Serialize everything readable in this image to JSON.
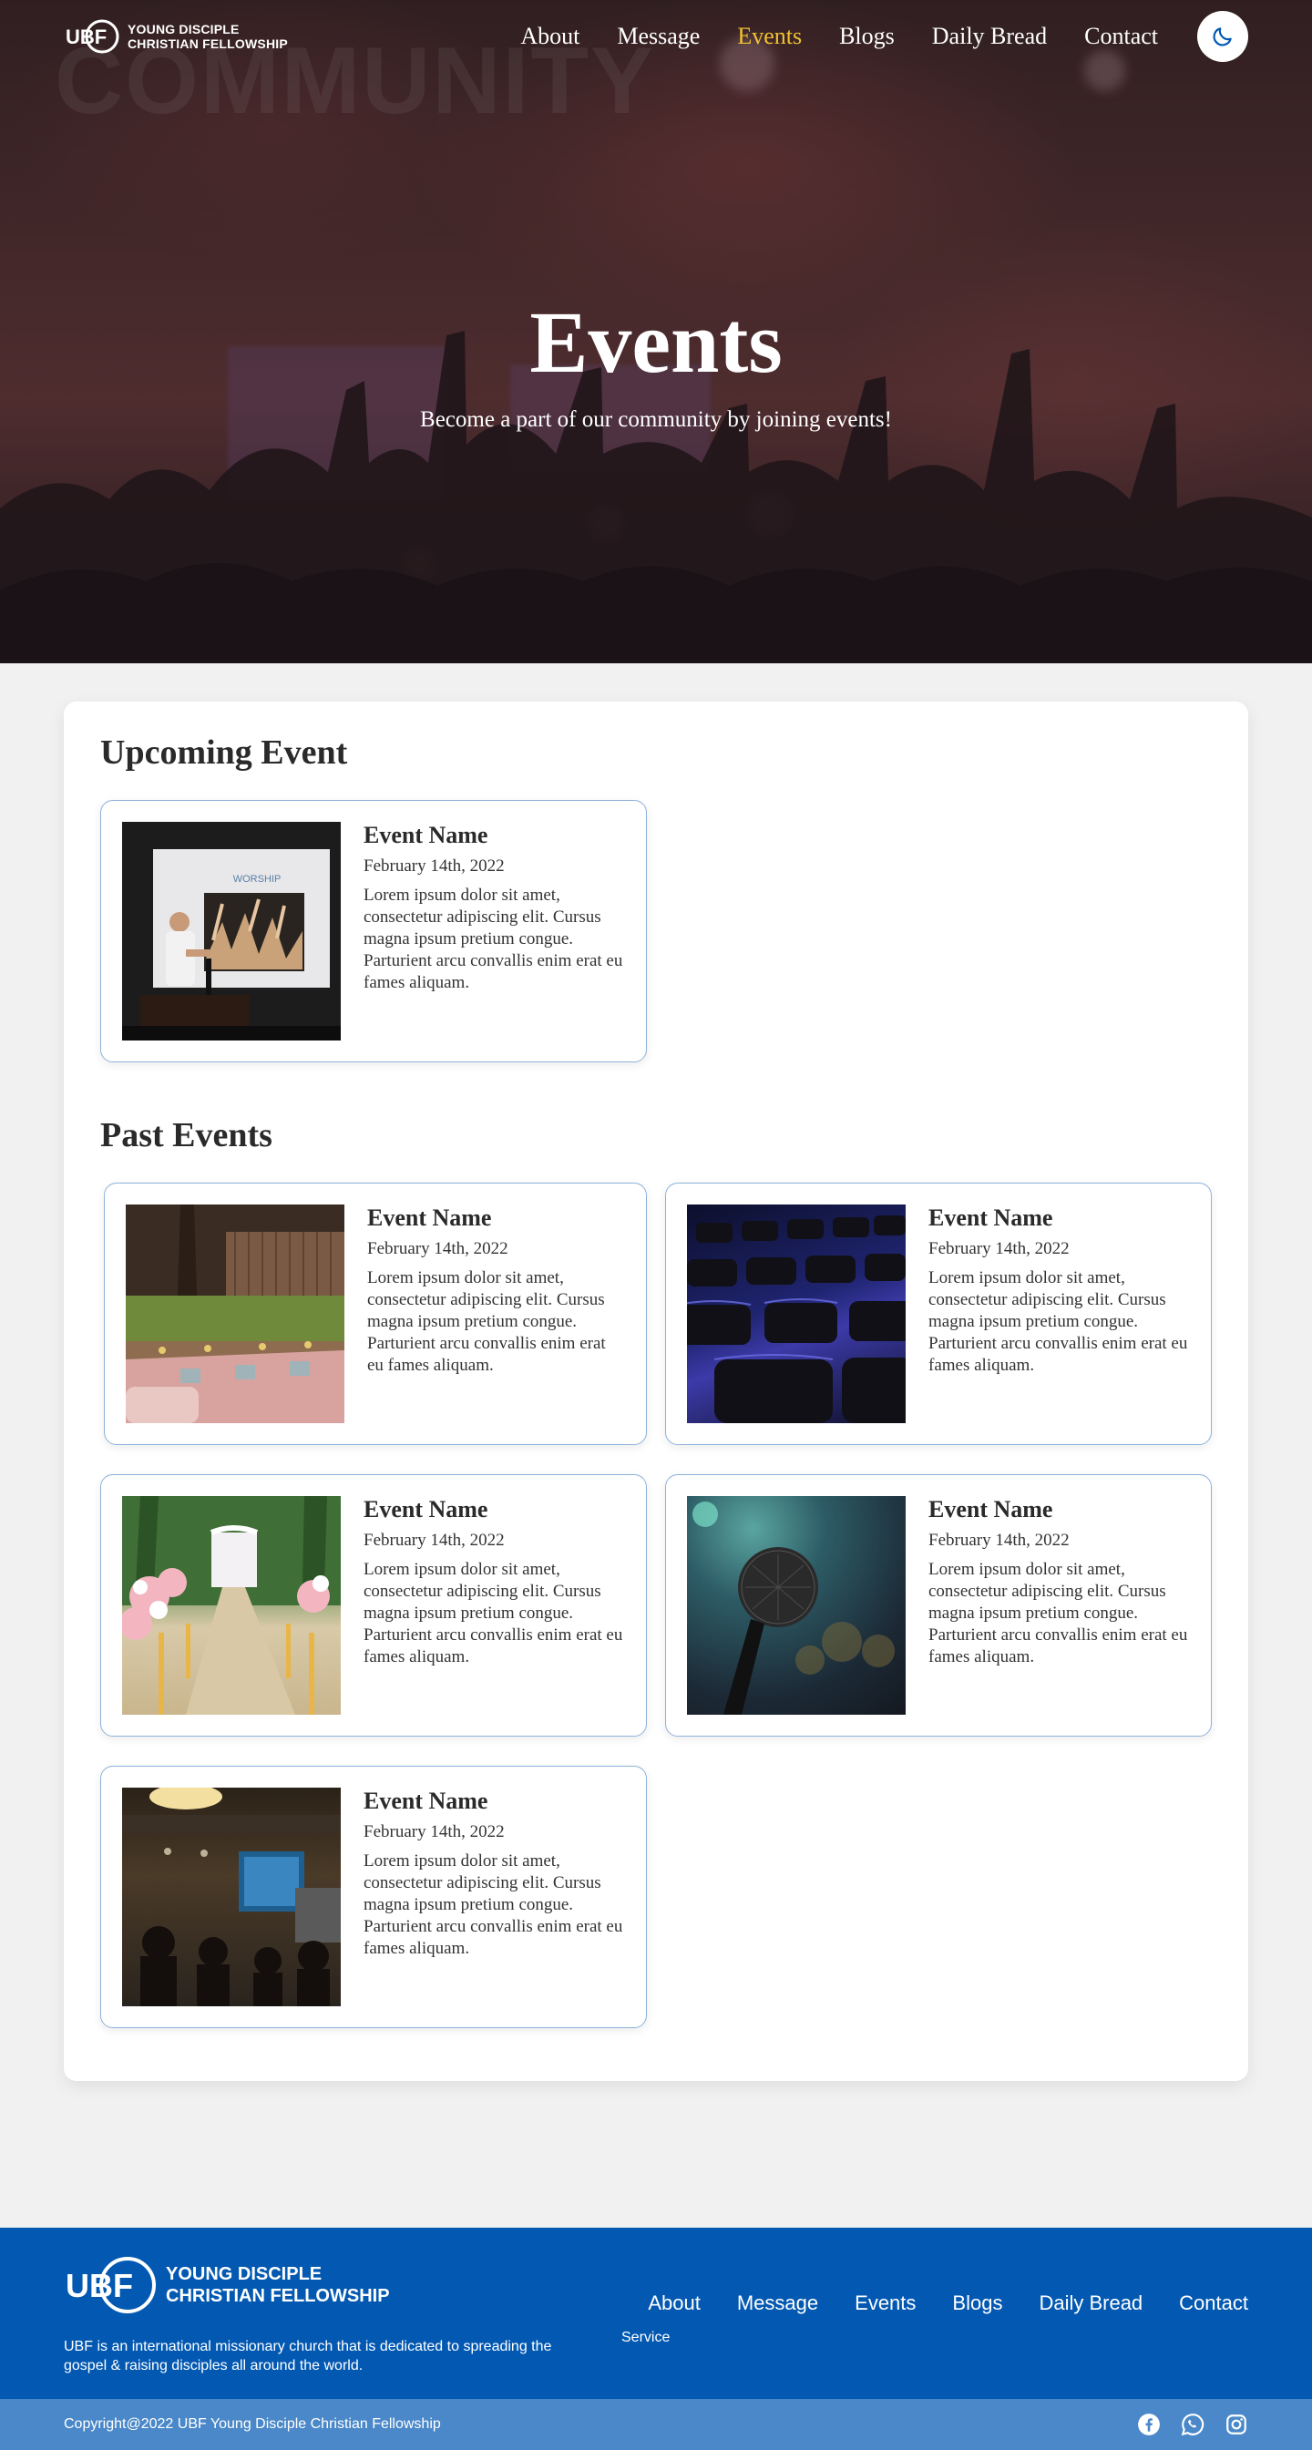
{
  "brand": {
    "line1": "YOUNG DISCIPLE",
    "line2": "CHRISTIAN FELLOWSHIP",
    "logo_letters": "UBF",
    "accent_color": "#f1c232",
    "primary_color": "#0359b2"
  },
  "nav": {
    "items": [
      {
        "label": "About"
      },
      {
        "label": "Message"
      },
      {
        "label": "Events",
        "active": true
      },
      {
        "label": "Blogs"
      },
      {
        "label": "Daily Bread"
      },
      {
        "label": "Contact"
      }
    ],
    "theme_toggle_icon": "moon-icon"
  },
  "hero": {
    "background_word": "COMMUNITY",
    "title": "Events",
    "subtitle": "Become a part of our community by joining events!"
  },
  "upcoming": {
    "heading": "Upcoming Event",
    "events": [
      {
        "image": "worship-presentation",
        "screen_text": "WORSHIP",
        "name": "Event Name",
        "date": "February 14th, 2022",
        "description": "Lorem ipsum dolor sit amet, consectetur adipiscing elit. Cursus magna ipsum pretium congue. Parturient arcu convallis enim erat eu fames aliquam."
      }
    ]
  },
  "past": {
    "heading": "Past Events",
    "events": [
      {
        "image": "garden-picnic",
        "name": "Event Name",
        "date": "February 14th, 2022",
        "description": "Lorem ipsum dolor sit amet, consectetur adipiscing elit. Cursus magna ipsum pretium congue. Parturient arcu convallis enim erat eu fames aliquam."
      },
      {
        "image": "empty-chairs",
        "name": "Event Name",
        "date": "February 14th, 2022",
        "description": "Lorem ipsum dolor sit amet, consectetur adipiscing elit. Cursus magna ipsum pretium congue. Parturient arcu convallis enim erat eu fames aliquam."
      },
      {
        "image": "flower-aisle",
        "name": "Event Name",
        "date": "February 14th, 2022",
        "description": "Lorem ipsum dolor sit amet, consectetur adipiscing elit. Cursus magna ipsum pretium congue. Parturient arcu convallis enim erat eu fames aliquam."
      },
      {
        "image": "microphone",
        "name": "Event Name",
        "date": "February 14th, 2022",
        "description": "Lorem ipsum dolor sit amet, consectetur adipiscing elit. Cursus magna ipsum pretium congue. Parturient arcu convallis enim erat eu fames aliquam."
      },
      {
        "image": "cafe-gathering",
        "name": "Event Name",
        "date": "February 14th, 2022",
        "description": "Lorem ipsum dolor sit amet, consectetur adipiscing elit. Cursus magna ipsum pretium congue. Parturient arcu convallis enim erat eu fames aliquam."
      }
    ]
  },
  "footer": {
    "brand_line1": "YOUNG DISCIPLE",
    "brand_line2": "CHRISTIAN FELLOWSHIP",
    "about": "UBF is an international missionary church that is dedicated to spreading the gospel & raising disciples all around the world.",
    "links": [
      {
        "label": "About"
      },
      {
        "label": "Message"
      },
      {
        "label": "Events"
      },
      {
        "label": "Blogs"
      },
      {
        "label": "Daily Bread"
      },
      {
        "label": "Contact"
      }
    ],
    "sub_link": "Service",
    "copyright": "Copyright@2022 UBF Young Disciple Christian Fellowship",
    "socials": [
      "facebook-icon",
      "whatsapp-icon",
      "instagram-icon"
    ]
  }
}
